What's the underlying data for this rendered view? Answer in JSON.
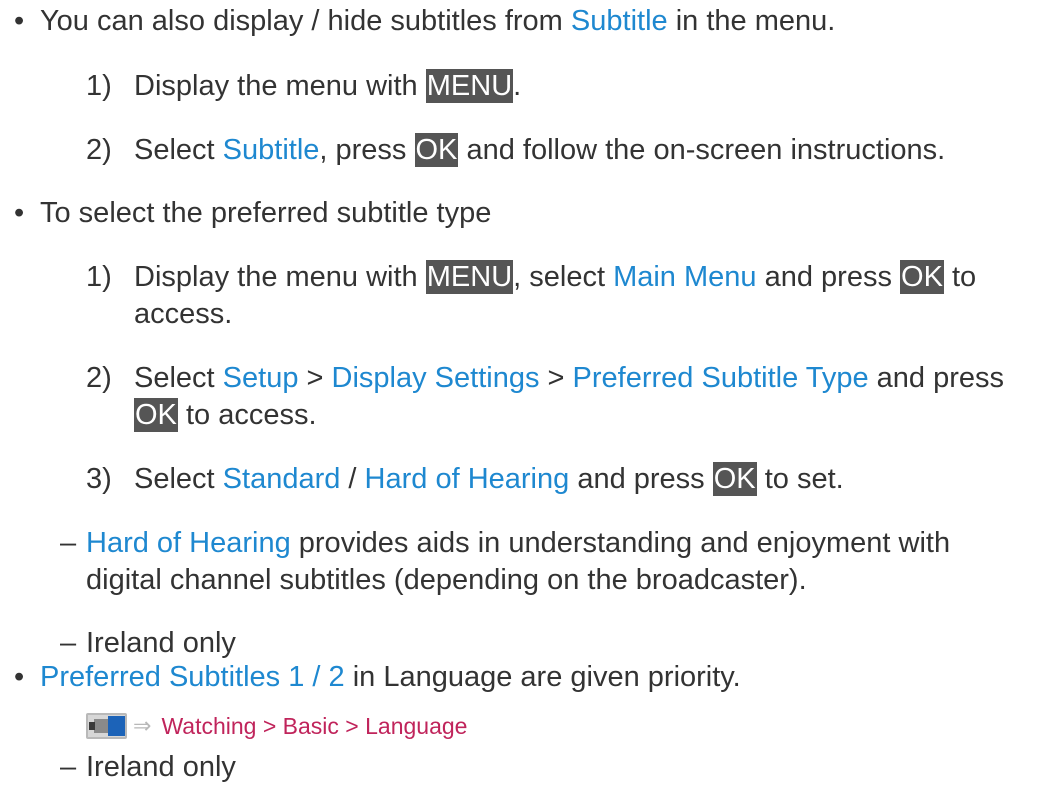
{
  "bullet_glyph": "•",
  "dash_glyph": "–",
  "sections": {
    "menu_tip": {
      "text_a": "You can also display / hide subtitles from ",
      "link": "Subtitle",
      "text_b": " in the menu.",
      "step1": {
        "num": "1)",
        "text_a": "Display the menu with ",
        "key": "MENU",
        "text_b": "."
      },
      "step2": {
        "num": "2)",
        "text_a": "Select ",
        "link": "Subtitle",
        "text_b": ", press ",
        "key": "OK",
        "text_c": " and follow the on-screen instructions."
      }
    },
    "preferred_type": {
      "text": "To select the preferred subtitle type",
      "step1": {
        "num": "1)",
        "text_a": "Display the menu with ",
        "key1": "MENU",
        "text_b": ", select ",
        "link": "Main Menu",
        "text_c": " and press ",
        "key2": "OK",
        "text_d": " to",
        "line2": "access."
      },
      "step2": {
        "num": "2)",
        "text_a": "Select ",
        "link1": "Setup",
        "sep1": " > ",
        "link2": "Display Settings",
        "sep2": " > ",
        "link3": "Preferred Subtitle Type",
        "text_b": " and press",
        "key": "OK",
        "line2": " to access."
      },
      "step3": {
        "num": "3)",
        "text_a": "Select ",
        "link1": "Standard",
        "sep": " / ",
        "link2": "Hard of Hearing",
        "text_b": " and press ",
        "key": "OK",
        "text_c": " to set."
      },
      "note1": {
        "link": "Hard of Hearing",
        "text_a": " provides aids in understanding and enjoyment with",
        "line2": "digital channel subtitles (depending on the broadcaster)."
      },
      "note2": {
        "text": "Ireland only"
      }
    },
    "priority": {
      "link": "Preferred Subtitles 1 / 2",
      "text": " in Language are given priority.",
      "reference": "Watching > Basic > Language",
      "reference_icon": "tv-menu-icon",
      "arrow_icon": "arrow-right-icon",
      "note": {
        "text": "Ireland only"
      }
    }
  },
  "colors": {
    "link": "#1e88d0",
    "key_bg": "#555555",
    "reference": "#c0245b",
    "text": "#333333"
  }
}
